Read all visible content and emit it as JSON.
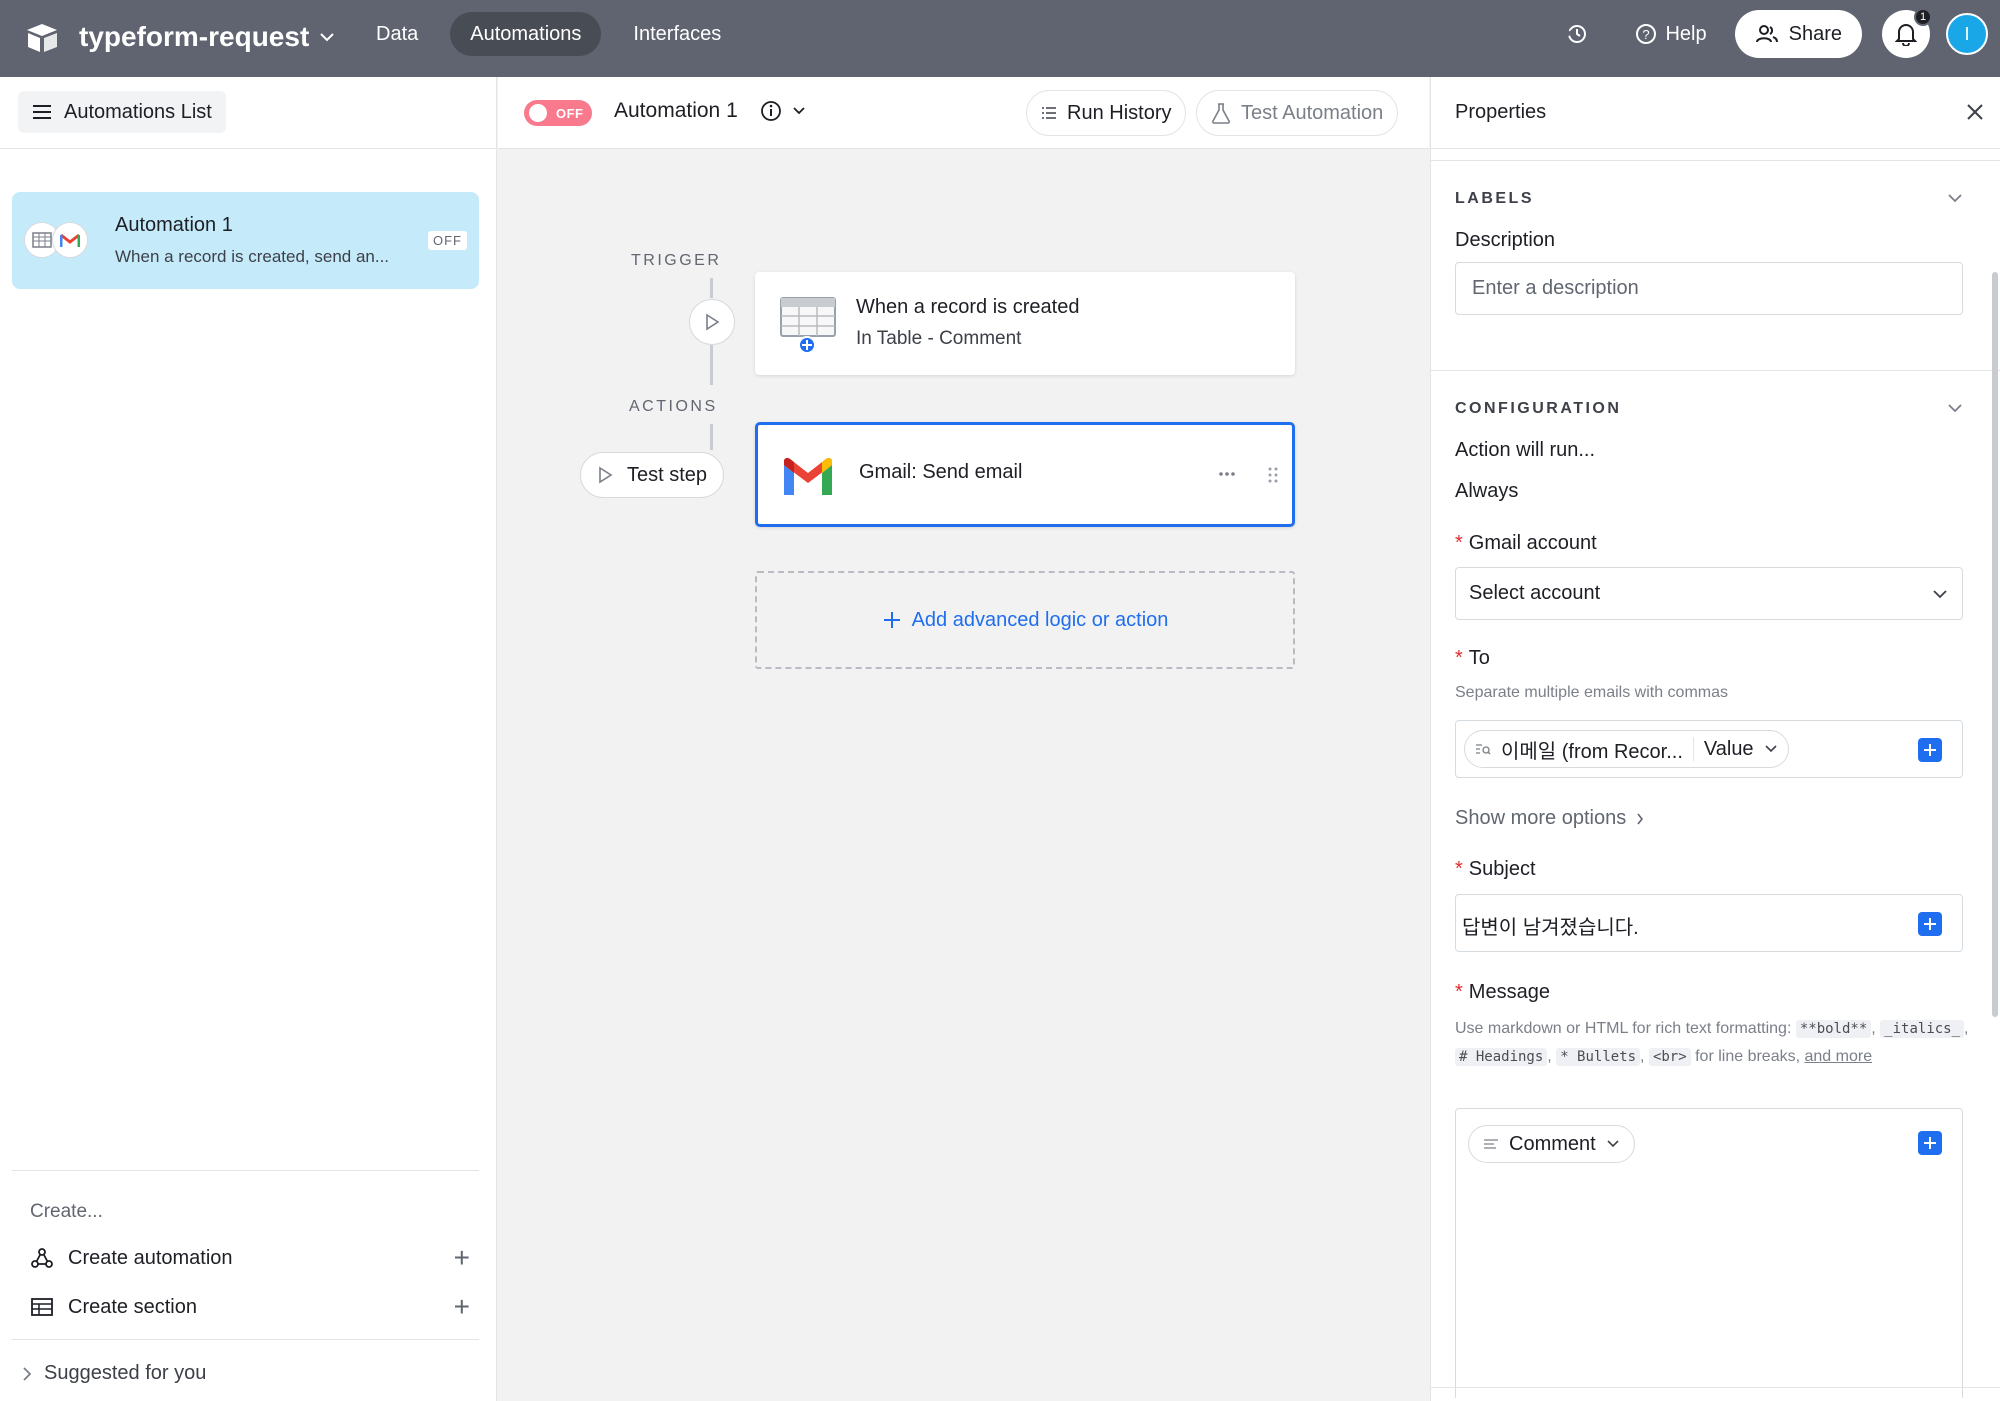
{
  "header": {
    "base_name": "typeform-request",
    "nav": [
      {
        "label": "Data",
        "active": false
      },
      {
        "label": "Automations",
        "active": true
      },
      {
        "label": "Interfaces",
        "active": false
      }
    ],
    "help_label": "Help",
    "share_label": "Share",
    "notification_count": "1",
    "avatar_initial": "I"
  },
  "sidebar": {
    "list_button_label": "Automations List",
    "automations": [
      {
        "title": "Automation 1",
        "description": "When a record is created, send an...",
        "status": "OFF"
      }
    ],
    "create_label": "Create...",
    "create_items": [
      {
        "label": "Create automation",
        "icon": "automation-icon"
      },
      {
        "label": "Create section",
        "icon": "section-icon"
      }
    ],
    "suggested_label": "Suggested for you"
  },
  "canvas": {
    "toggle_label": "OFF",
    "automation_title": "Automation 1",
    "run_history_label": "Run History",
    "test_automation_label": "Test Automation",
    "trigger_label": "TRIGGER",
    "actions_label": "ACTIONS",
    "trigger_card": {
      "title": "When a record is created",
      "subtitle": "In Table - Comment"
    },
    "action_card": {
      "title": "Gmail: Send email"
    },
    "test_step_label": "Test step",
    "add_logic_label": "Add advanced logic or action"
  },
  "properties": {
    "title": "Properties",
    "labels_section": "LABELS",
    "description_label": "Description",
    "description_placeholder": "Enter a description",
    "configuration_section": "CONFIGURATION",
    "action_will_run_label": "Action will run...",
    "action_will_run_value": "Always",
    "gmail_account_label": "Gmail account",
    "gmail_account_value": "Select account",
    "to_label": "To",
    "to_hint": "Separate multiple emails with commas",
    "to_chip_field": "이메일 (from Recor...",
    "to_chip_value": "Value",
    "show_more_label": "Show more options",
    "subject_label": "Subject",
    "subject_value": "답변이 남겨졌습니다.",
    "message_label": "Message",
    "message_hint": {
      "prefix": "Use markdown or HTML for rich text formatting:",
      "bold": "**bold**",
      "italics": "_italics_",
      "headings": "# Headings",
      "bullets": "* Bullets",
      "br": "<br>",
      "suffix": "for line breaks,",
      "link": "and more"
    },
    "message_chip": "Comment"
  },
  "colors": {
    "topbar": "#5f6470",
    "accent_blue": "#1f6ef0",
    "selected_card": "#c5ebfb",
    "toggle_off": "#f87a8c",
    "required": "#e02c2c"
  }
}
